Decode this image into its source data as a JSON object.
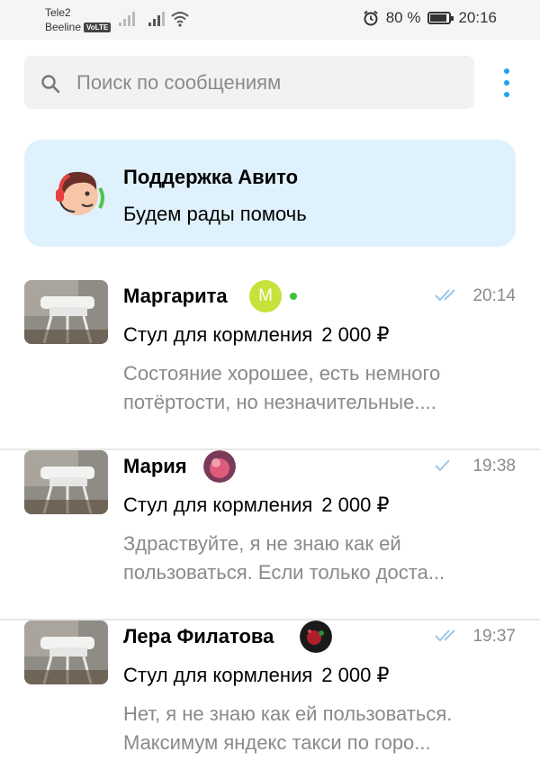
{
  "status_bar": {
    "carrier1": "Tele2",
    "carrier2": "Beeline",
    "volte": "VoLTE",
    "battery": "80 %",
    "time": "20:16"
  },
  "search": {
    "placeholder": "Поиск по сообщениям"
  },
  "support": {
    "title": "Поддержка Авито",
    "subtitle": "Будем рады помочь"
  },
  "chats": [
    {
      "name": "Маргарита",
      "badge_letter": "М",
      "online": true,
      "read_status": "read",
      "time": "20:14",
      "item": "Стул для кормления",
      "price": "2 000 ₽",
      "message": "Состояние хорошее, есть немного потёртости, но незначительные...."
    },
    {
      "name": "Мария",
      "read_status": "sent",
      "time": "19:38",
      "item": "Стул для кормления",
      "price": "2 000 ₽",
      "message": "Здраствуйте, я не знаю как ей пользоваться. Если только доста..."
    },
    {
      "name": "Лера Филатова",
      "read_status": "read",
      "time": "19:37",
      "item": "Стул для кормления",
      "price": "2 000 ₽",
      "message": "Нет, я не знаю как ей пользоваться. Максимум яндекс такси по горо..."
    }
  ],
  "colors": {
    "accent": "#1da1f2",
    "support_bg": "#dff1fc",
    "online": "#3cc13b",
    "badge_green": "#c7e23a",
    "muted_text": "#8a8a8a"
  }
}
